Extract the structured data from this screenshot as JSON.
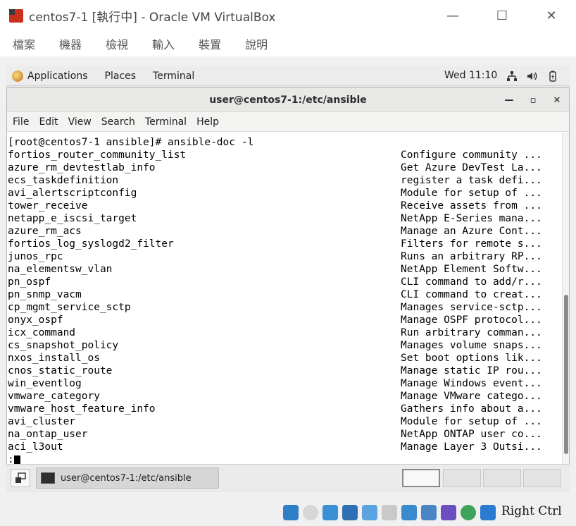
{
  "vbox": {
    "window_title": "centos7-1 [執行中] - Oracle VM VirtualBox",
    "window_buttons": {
      "minimize": "—",
      "maximize": "☐",
      "close": "✕"
    },
    "menu": [
      "檔案",
      "機器",
      "檢視",
      "輸入",
      "裝置",
      "說明"
    ],
    "host_key_label": "Right Ctrl"
  },
  "gnome_topbar": {
    "applications": "Applications",
    "places": "Places",
    "terminal": "Terminal",
    "clock": "Wed 11:10"
  },
  "terminal": {
    "title": "user@centos7-1:/etc/ansible",
    "controls": {
      "minimize": "—",
      "maximize": "▫",
      "close": "✕"
    },
    "menu": [
      "File",
      "Edit",
      "View",
      "Search",
      "Terminal",
      "Help"
    ],
    "prompt_line": "[root@centos7-1 ansible]# ansible-doc -l",
    "rows": [
      {
        "module": "fortios_router_community_list",
        "desc": "Configure community ..."
      },
      {
        "module": "azure_rm_devtestlab_info",
        "desc": "Get Azure DevTest La..."
      },
      {
        "module": "ecs_taskdefinition",
        "desc": "register a task defi..."
      },
      {
        "module": "avi_alertscriptconfig",
        "desc": "Module for setup of ..."
      },
      {
        "module": "tower_receive",
        "desc": "Receive assets from ..."
      },
      {
        "module": "netapp_e_iscsi_target",
        "desc": "NetApp E-Series mana..."
      },
      {
        "module": "azure_rm_acs",
        "desc": "Manage an Azure Cont..."
      },
      {
        "module": "fortios_log_syslogd2_filter",
        "desc": "Filters for remote s..."
      },
      {
        "module": "junos_rpc",
        "desc": "Runs an arbitrary RP..."
      },
      {
        "module": "na_elementsw_vlan",
        "desc": "NetApp Element Softw..."
      },
      {
        "module": "pn_ospf",
        "desc": "CLI command to add/r..."
      },
      {
        "module": "pn_snmp_vacm",
        "desc": "CLI command to creat..."
      },
      {
        "module": "cp_mgmt_service_sctp",
        "desc": "Manages service-sctp..."
      },
      {
        "module": "onyx_ospf",
        "desc": "Manage OSPF protocol..."
      },
      {
        "module": "icx_command",
        "desc": "Run arbitrary comman..."
      },
      {
        "module": "cs_snapshot_policy",
        "desc": "Manages volume snaps..."
      },
      {
        "module": "nxos_install_os",
        "desc": "Set boot options lik..."
      },
      {
        "module": "cnos_static_route",
        "desc": "Manage static IP rou..."
      },
      {
        "module": "win_eventlog",
        "desc": "Manage Windows event..."
      },
      {
        "module": "vmware_category",
        "desc": "Manage VMware catego..."
      },
      {
        "module": "vmware_host_feature_info",
        "desc": "Gathers info about a..."
      },
      {
        "module": "avi_cluster",
        "desc": "Module for setup of ..."
      },
      {
        "module": "na_ontap_user",
        "desc": "NetApp ONTAP user co..."
      },
      {
        "module": "aci_l3out",
        "desc": "Manage Layer 3 Outsi..."
      }
    ],
    "pager_prompt": ":"
  },
  "bottom_panel": {
    "task_label": "user@centos7-1:/etc/ansible",
    "workspaces": 4
  },
  "colors": {
    "accent_red": "#c9301e",
    "terminal_bg": "#ffffff",
    "panel_bg": "#ebebeb"
  }
}
